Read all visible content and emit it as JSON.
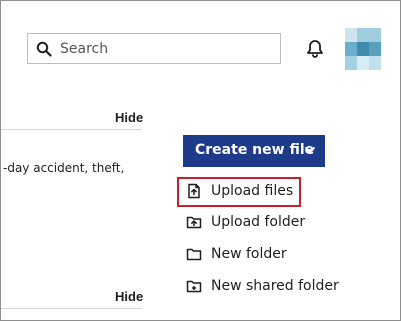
{
  "header": {
    "search": {
      "placeholder": "Search",
      "value": ""
    },
    "icons": {
      "search": "search-icon",
      "notifications": "bell-icon",
      "avatar": "avatar"
    }
  },
  "content": {
    "hide_top_label": "Hide",
    "snippet_text": "-day accident, theft,",
    "hide_bottom_label": "Hide"
  },
  "menu": {
    "create_button_label": "Create new file",
    "create_button_icon": "chevron-down-icon",
    "items": [
      {
        "label": "Upload files",
        "icon": "upload-file-icon",
        "highlighted": true
      },
      {
        "label": "Upload folder",
        "icon": "upload-folder-icon",
        "highlighted": false
      },
      {
        "label": "New folder",
        "icon": "folder-icon",
        "highlighted": false
      },
      {
        "label": "New shared folder",
        "icon": "shared-folder-icon",
        "highlighted": false
      }
    ]
  },
  "colors": {
    "primary_button": "#1e3a8a",
    "highlight_outline": "#c71f2e",
    "avatar_light": "#cfe4ec",
    "avatar_medium": "#8fc3d7",
    "avatar_dark": "#3f8bab"
  }
}
